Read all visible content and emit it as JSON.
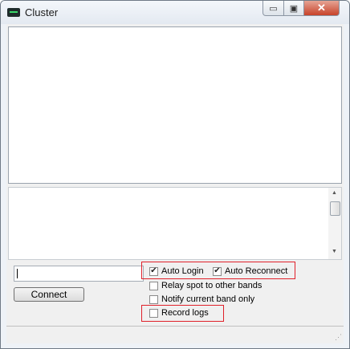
{
  "window": {
    "title": "Cluster"
  },
  "window_controls": {
    "minimize": "▭",
    "maximize": "▣",
    "close": "✕"
  },
  "scrollbar": {
    "up_arrow": "▲",
    "down_arrow": "▼"
  },
  "command": {
    "value": ""
  },
  "buttons": {
    "connect": "Connect"
  },
  "options": [
    {
      "label": "Auto Login",
      "checked": true
    },
    {
      "label": "Auto Reconnect",
      "checked": true
    },
    {
      "label": "Relay spot to other bands",
      "checked": false
    },
    {
      "label": "Notify current band only",
      "checked": false
    },
    {
      "label": "Record logs",
      "checked": false
    }
  ],
  "highlight_color": "#e0202a",
  "icons": {
    "app": "cluster-app-icon",
    "grip": "resize-grip-icon"
  }
}
